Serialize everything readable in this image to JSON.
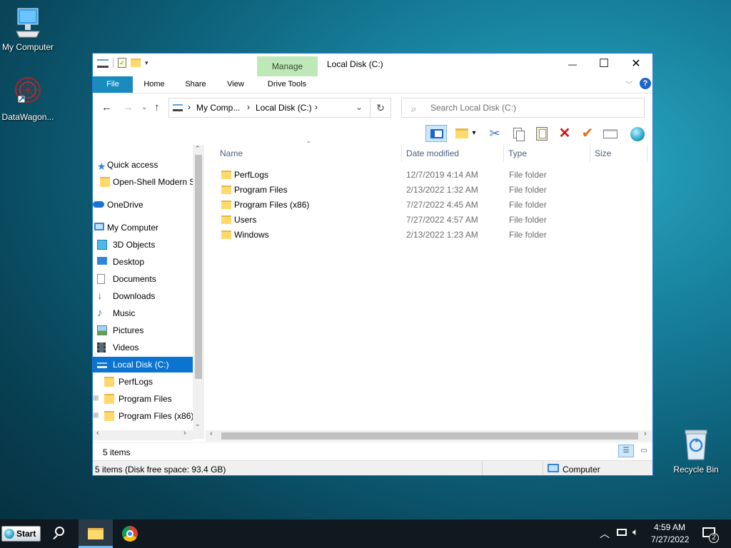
{
  "desktop": {
    "icons": [
      {
        "label": "My Computer",
        "icon": "monitor-icon"
      },
      {
        "label": "DataWagon...",
        "icon": "datawagon-icon"
      },
      {
        "label": "Recycle Bin",
        "icon": "recycle-bin-icon"
      }
    ]
  },
  "window": {
    "title": "Local Disk (C:)",
    "context_tab": "Manage",
    "tabs": [
      "File",
      "Home",
      "Share",
      "View",
      "Drive Tools"
    ],
    "controls": {
      "minimize": "—",
      "maximize": "☐",
      "close": "✕"
    },
    "address": {
      "crumbs": [
        "My Comp...",
        "Local Disk (C:)"
      ],
      "separator": "›"
    },
    "search_placeholder": "Search Local Disk (C:)",
    "columns": [
      "Name",
      "Date modified",
      "Type",
      "Size"
    ],
    "files": [
      {
        "name": "PerfLogs",
        "date": "12/7/2019 4:14 AM",
        "type": "File folder"
      },
      {
        "name": "Program Files",
        "date": "2/13/2022 1:32 AM",
        "type": "File folder"
      },
      {
        "name": "Program Files (x86)",
        "date": "7/27/2022 4:45 AM",
        "type": "File folder"
      },
      {
        "name": "Users",
        "date": "7/27/2022 4:57 AM",
        "type": "File folder"
      },
      {
        "name": "Windows",
        "date": "2/13/2022 1:23 AM",
        "type": "File folder"
      }
    ],
    "nav": [
      {
        "label": "Quick access",
        "icon": "star-icon"
      },
      {
        "label": "Open-Shell Modern S",
        "icon": "folder-icon"
      },
      {
        "label": "OneDrive",
        "icon": "cloud-icon"
      },
      {
        "label": "My Computer",
        "icon": "monitor-icon"
      },
      {
        "label": "3D Objects",
        "icon": "cube-icon"
      },
      {
        "label": "Desktop",
        "icon": "desktop-icon"
      },
      {
        "label": "Documents",
        "icon": "document-icon"
      },
      {
        "label": "Downloads",
        "icon": "download-icon"
      },
      {
        "label": "Music",
        "icon": "music-icon"
      },
      {
        "label": "Pictures",
        "icon": "picture-icon"
      },
      {
        "label": "Videos",
        "icon": "video-icon"
      },
      {
        "label": "Local Disk (C:)",
        "icon": "drive-icon"
      },
      {
        "label": "PerfLogs",
        "icon": "folder-icon"
      },
      {
        "label": "Program Files",
        "icon": "folder-icon"
      },
      {
        "label": "Program Files (x86)",
        "icon": "folder-icon"
      }
    ],
    "item_count": "5 items",
    "status_detail": "5 items (Disk free space: 93.4 GB)",
    "status_location": "Computer"
  },
  "taskbar": {
    "start_label": "Start",
    "time": "4:59 AM",
    "date": "7/27/2022",
    "notification_count": "2"
  },
  "colors": {
    "accent": "#0a74d0",
    "file_tab": "#1a8bbf",
    "manage_tab": "#bfe8b8",
    "folder": "#ffd96b"
  }
}
